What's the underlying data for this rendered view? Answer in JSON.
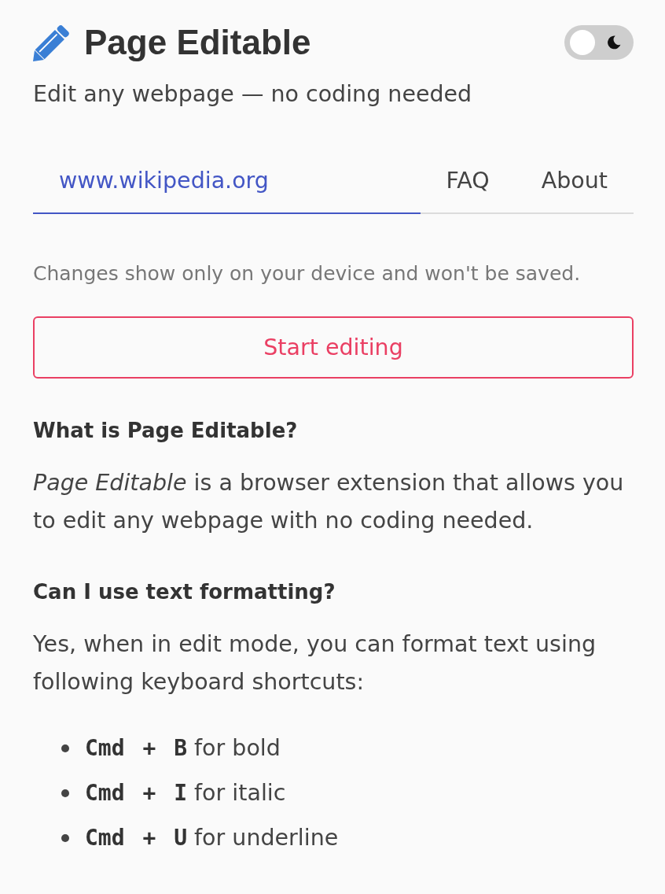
{
  "header": {
    "title": "Page Editable",
    "subtitle": "Edit any webpage — no coding needed",
    "dark_mode_toggle": {
      "on": false
    }
  },
  "tabs": [
    {
      "label": "www.wikipedia.org",
      "selected": true
    },
    {
      "label": "FAQ",
      "selected": false
    },
    {
      "label": "About",
      "selected": false
    }
  ],
  "note": "Changes show only on your device and won't be saved.",
  "start_button": {
    "label": "Start editing"
  },
  "faq": [
    {
      "question": "What is Page Editable?",
      "answer": "*Page Editable* is a browser extension that allows you to edit any webpage with no coding needed."
    },
    {
      "question": "Can I use text formatting?",
      "answer": "Yes, when in edit mode, you can format text using following keyboard shortcuts:",
      "shortcuts": [
        {
          "keys": "Cmd + B",
          "action": "for bold"
        },
        {
          "keys": "Cmd + I",
          "action": "for italic"
        },
        {
          "keys": "Cmd + U",
          "action": "for underline"
        }
      ]
    }
  ]
}
